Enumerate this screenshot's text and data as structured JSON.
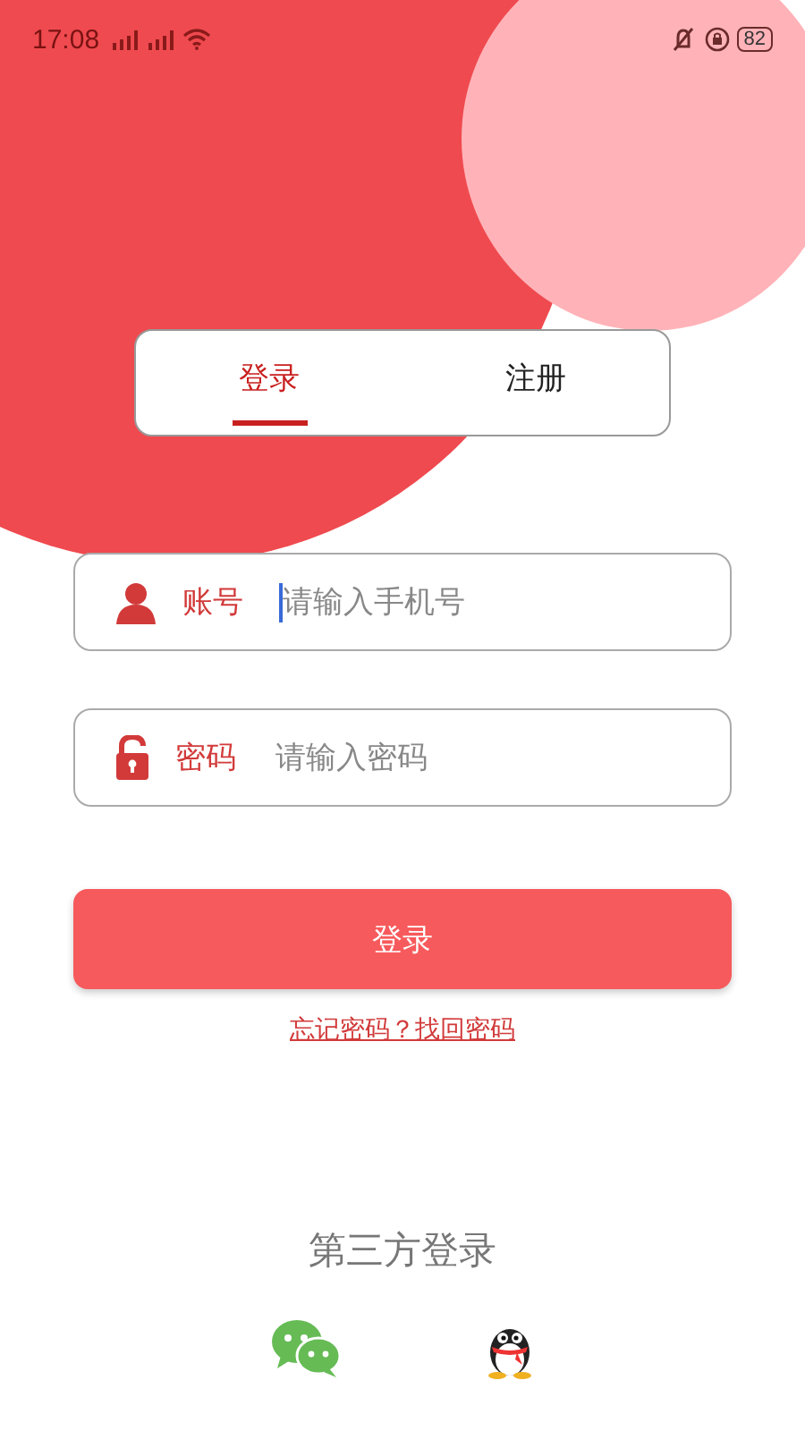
{
  "status_bar": {
    "time": "17:08",
    "battery": "82"
  },
  "tabs": [
    {
      "label": "登录",
      "selected": true
    },
    {
      "label": "注册",
      "selected": false
    }
  ],
  "fields": [
    {
      "kind": "user",
      "label": "账号",
      "placeholder": "请输入手机号",
      "focused": true
    },
    {
      "kind": "lock",
      "label": "密码",
      "placeholder": "请输入密码",
      "focused": false
    }
  ],
  "login_button": "登录",
  "forgot_link": "忘记密码？找回密码",
  "third_party": {
    "title": "第三方登录",
    "options": [
      {
        "kind": "wechat"
      },
      {
        "kind": "qq"
      }
    ]
  }
}
